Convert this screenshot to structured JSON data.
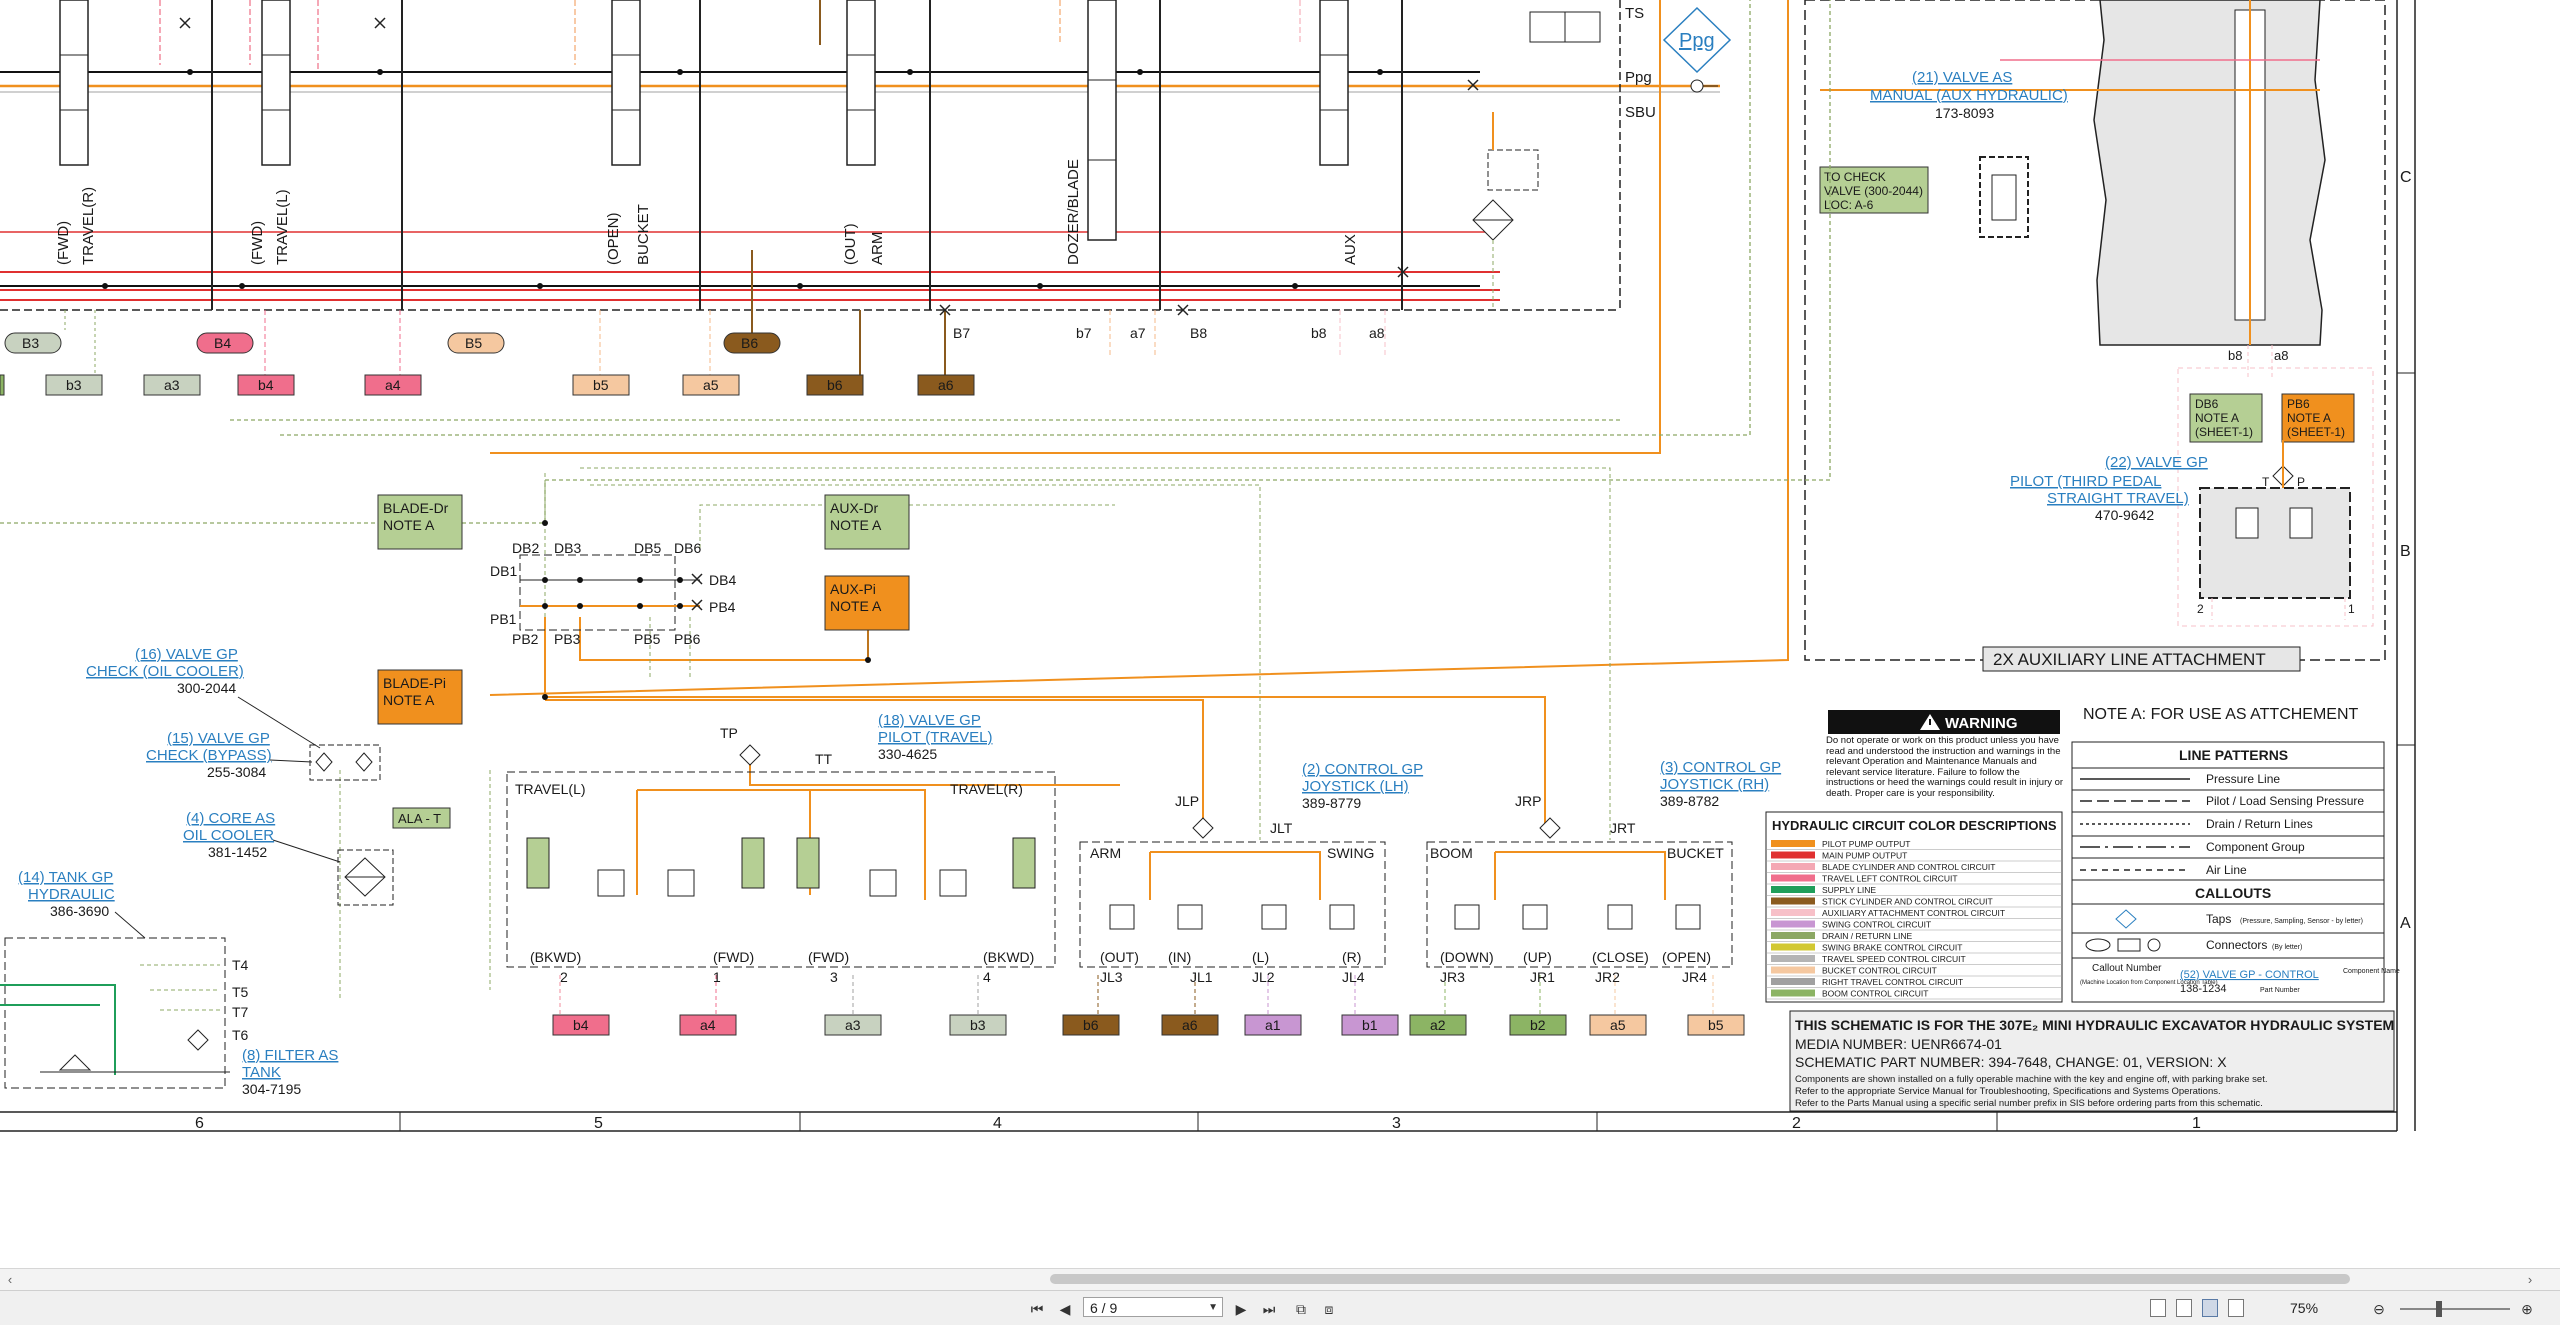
{
  "schematic": {
    "top_labels": {
      "ts": "TS",
      "ppg": "Ppg",
      "sbu": "SBU",
      "ppg_badge": "Ppg"
    },
    "valve_sections": [
      {
        "dir": "(FWD)",
        "name": "TRAVEL(R)"
      },
      {
        "dir": "(FWD)",
        "name": "TRAVEL(L)"
      },
      {
        "dir": "(OPEN)",
        "name": "BUCKET"
      },
      {
        "dir": "(OUT)",
        "name": "ARM"
      },
      {
        "dir": "",
        "name": "DOZER/BLADE"
      },
      {
        "dir": "",
        "name": "AUX"
      }
    ],
    "port_labels_upper": [
      "B3",
      "B4",
      "B5",
      "B6"
    ],
    "port_labels_letters": [
      "B7",
      "b7",
      "a7",
      "B8",
      "b8",
      "a8"
    ],
    "port_tags_lower": [
      "b3",
      "a3",
      "b4",
      "a4",
      "b5",
      "a5",
      "b6",
      "a6"
    ],
    "aux_valve": {
      "title_1": "(21) VALVE AS",
      "title_2": "MANUAL (AUX HYDRAULIC)",
      "part": "173-8093"
    },
    "check_valve_note": [
      "TO CHECK",
      "VALVE (300-2044)",
      "LOC: A-6"
    ],
    "aux_ports": [
      "b8",
      "a8"
    ],
    "notes": [
      {
        "line1": "DB6",
        "line2": "NOTE A",
        "line3": "(SHEET-1)"
      },
      {
        "line1": "PB6",
        "line2": "NOTE A",
        "line3": "(SHEET-1)"
      }
    ],
    "third_pedal_valve": {
      "title_1": "(22) VALVE GP",
      "title_2": "PILOT (THIRD PEDAL",
      "title_3": "STRAIGHT TRAVEL)",
      "part": "470-9642",
      "port_t": "T",
      "port_p": "P",
      "port_2": "2",
      "port_1": "1"
    },
    "aux_attachment_title": "2X AUXILIARY LINE ATTACHMENT",
    "note_a": "NOTE A: FOR USE AS ATTCHEMENT",
    "blade_dr": [
      "BLADE-Dr",
      "NOTE A"
    ],
    "blade_pi": [
      "BLADE-Pi",
      "NOTE A"
    ],
    "aux_dr": [
      "AUX-Dr",
      "NOTE A"
    ],
    "aux_pi": [
      "AUX-Pi",
      "NOTE A"
    ],
    "db_labels": [
      "DB2",
      "DB3",
      "DB5",
      "DB6",
      "DB1",
      "DB4"
    ],
    "pb_labels": [
      "PB1",
      "PB4",
      "PB2",
      "PB3",
      "PB5",
      "PB6"
    ],
    "check_oil_cooler": {
      "title_1": "(16) VALVE GP",
      "title_2": "CHECK (OIL COOLER)",
      "part": "300-2044"
    },
    "check_bypass": {
      "title_1": "(15) VALVE GP",
      "title_2": "CHECK (BYPASS)",
      "part": "255-3084"
    },
    "oil_cooler": {
      "title_1": "(4) CORE AS",
      "title_2": "OIL COOLER",
      "part": "381-1452"
    },
    "tank": {
      "title_1": "(14) TANK GP",
      "title_2": "HYDRAULIC",
      "part": "386-3690"
    },
    "ala_t": "ALA - T",
    "tank_ports": [
      "T4",
      "T5",
      "T7",
      "T6"
    ],
    "filter": {
      "title_1": "(8) FILTER AS",
      "title_2": "TANK",
      "part": "304-7195"
    },
    "pilot_travel": {
      "title_1": "(18) VALVE GP",
      "title_2": "PILOT (TRAVEL)",
      "part": "330-4625",
      "tp": "TP",
      "tt": "TT",
      "left": "TRAVEL(L)",
      "right": "TRAVEL(R)"
    },
    "travel_ports": [
      "(BKWD)",
      "(FWD)",
      "(FWD)",
      "(BKWD)"
    ],
    "travel_nums": [
      "2",
      "1",
      "3",
      "4"
    ],
    "joystick_lh": {
      "title_1": "(2) CONTROL GP",
      "title_2": "JOYSTICK (LH)",
      "part": "389-8779",
      "jlp": "JLP",
      "jlt": "JLT",
      "left": "ARM",
      "right": "SWING"
    },
    "joystick_lh_ports": [
      "(OUT)",
      "(IN)",
      "(L)",
      "(R)"
    ],
    "joystick_lh_codes": [
      "JL3",
      "JL1",
      "JL2",
      "JL4"
    ],
    "joystick_rh": {
      "title_1": "(3) CONTROL GP",
      "title_2": "JOYSTICK (RH)",
      "part": "389-8782",
      "jrp": "JRP",
      "jrt": "JRT",
      "left": "BOOM",
      "right": "BUCKET"
    },
    "joystick_rh_ports": [
      "(DOWN)",
      "(UP)",
      "(CLOSE)",
      "(OPEN)"
    ],
    "joystick_rh_codes": [
      "JR3",
      "JR1",
      "JR2",
      "JR4"
    ],
    "bottom_tags": [
      "b4",
      "a4",
      "a3",
      "b3",
      "b6",
      "a6",
      "a1",
      "b1",
      "a2",
      "b2",
      "a5",
      "b5"
    ],
    "warning": {
      "title": "WARNING",
      "body": "Do not operate or work on this product unless you have read and understood the instruction and warnings in the relevant Operation and Maintenance Manuals and relevant service literature. Failure to follow the instructions or heed the warnings could result in injury or death. Proper care is your responsibility."
    },
    "color_legend": {
      "title": "HYDRAULIC CIRCUIT COLOR DESCRIPTIONS",
      "items": [
        {
          "label": "PILOT PUMP OUTPUT",
          "color": "#f0901e"
        },
        {
          "label": "MAIN PUMP OUTPUT",
          "color": "#e03030"
        },
        {
          "label": "BLADE CYLINDER AND CONTROL CIRCUIT",
          "color": "#f4a8b4"
        },
        {
          "label": "TRAVEL LEFT CONTROL CIRCUIT",
          "color": "#f06e8c"
        },
        {
          "label": "SUPPLY LINE",
          "color": "#1f9e5a"
        },
        {
          "label": "STICK CYLINDER AND CONTROL CIRCUIT",
          "color": "#8a5a1e"
        },
        {
          "label": "AUXILIARY ATTACHMENT CONTROL CIRCUIT",
          "color": "#f7c0c8"
        },
        {
          "label": "SWING CONTROL CIRCUIT",
          "color": "#c896d2"
        },
        {
          "label": "DRAIN / RETURN LINE",
          "color": "#8ca864"
        },
        {
          "label": "SWING BRAKE CONTROL CIRCUIT",
          "color": "#d2c832"
        },
        {
          "label": "TRAVEL SPEED CONTROL CIRCUIT",
          "color": "#b4b4b4"
        },
        {
          "label": "BUCKET CONTROL CIRCUIT",
          "color": "#f5c8a0"
        },
        {
          "label": "RIGHT TRAVEL CONTROL CIRCUIT",
          "color": "#a0a0a0"
        },
        {
          "label": "BOOM CONTROL CIRCUIT",
          "color": "#8cb464"
        }
      ]
    },
    "line_patterns": {
      "title": "LINE PATTERNS",
      "items": [
        "Pressure Line",
        "Pilot / Load Sensing Pressure",
        "Drain / Return Lines",
        "Component Group",
        "Air Line"
      ],
      "callouts_title": "CALLOUTS",
      "taps": "Taps",
      "taps_note": "(Pressure, Sampling, Sensor - by letter)",
      "connectors": "Connectors",
      "connectors_note": "(By letter)",
      "callout_number": "Callout Number",
      "callout_machine": "(Machine Location from Component Location Table)",
      "callout_example": "(52) VALVE GP - CONTROL",
      "callout_component": "Component Name",
      "callout_part": "138-1234",
      "callout_part_label": "Part Number"
    },
    "title_block": {
      "line1": "THIS SCHEMATIC IS FOR THE 307E₂ MINI HYDRAULIC EXCAVATOR HYDRAULIC SYSTEM",
      "line2": "MEDIA NUMBER: UENR6674-01",
      "line3": "SCHEMATIC PART NUMBER: 394-7648, CHANGE: 01, VERSION: X",
      "line4": "Components are shown installed on a fully operable machine with the key and engine off, with parking brake set.",
      "line5": "Refer to the appropriate Service Manual for Troubleshooting, Specifications and Systems Operations.",
      "line6": "Refer to the Parts Manual using a specific serial number prefix in SIS before ordering parts from this schematic."
    },
    "grid_cols": [
      "6",
      "5",
      "4",
      "3",
      "2",
      "1"
    ],
    "grid_rows": [
      "C",
      "B",
      "A"
    ]
  },
  "viewer": {
    "page_indicator": "6 / 9",
    "zoom": "75%"
  }
}
